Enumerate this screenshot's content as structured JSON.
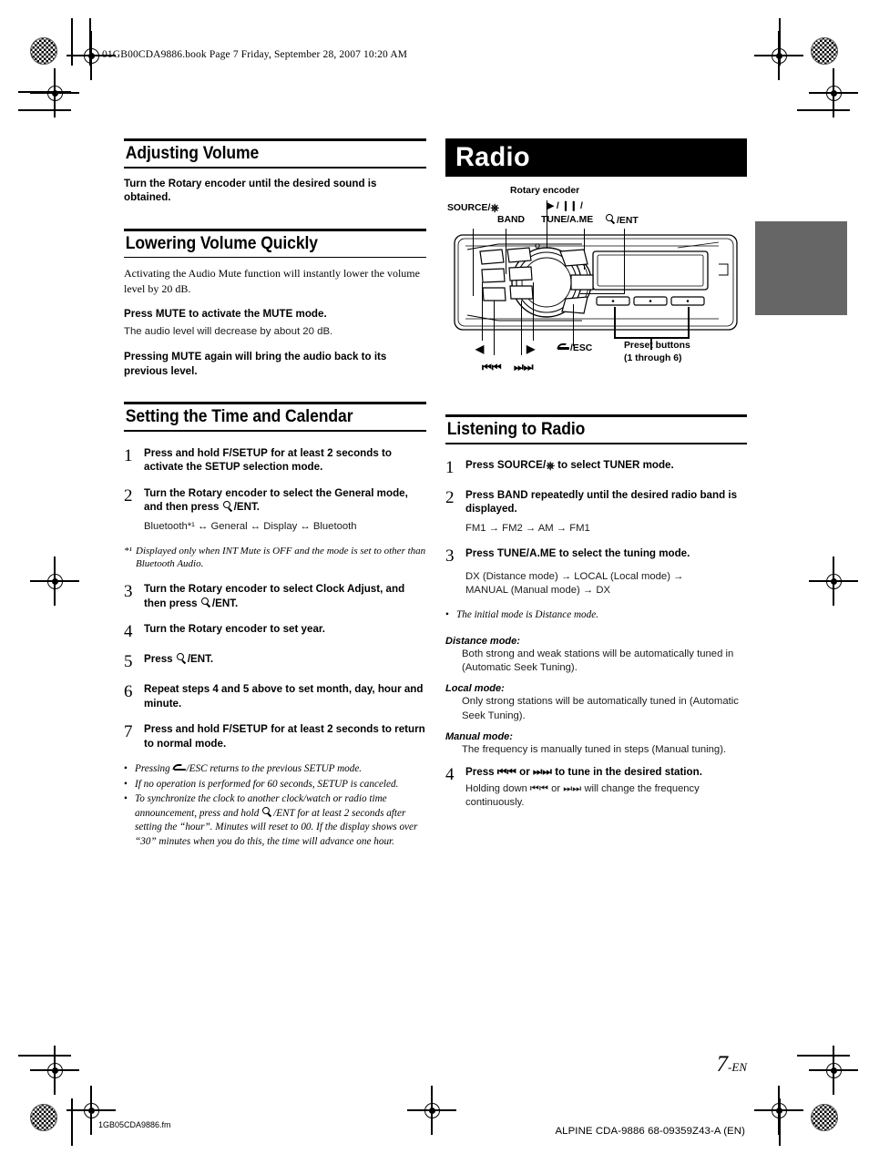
{
  "header": {
    "book_line": "01GB00CDA9886.book  Page 7  Friday, September 28, 2007  10:20 AM"
  },
  "left_column": {
    "section1": {
      "heading": "Adjusting Volume",
      "body_bold": "Turn the Rotary encoder until the desired sound is obtained.",
      "body_parts": {
        "pre": "Turn the ",
        "bold": "Rotary encoder",
        "post": " until the desired sound is obtained."
      }
    },
    "section2": {
      "heading": "Lowering Volume Quickly",
      "intro": "Activating the Audio Mute function will instantly lower the volume level by 20 dB.",
      "press_mute": {
        "pre": "Press ",
        "key": "MUTE",
        "post": " to activate the MUTE mode."
      },
      "press_mute_sub": "The audio level will decrease by about 20 dB.",
      "press_again": {
        "pre": "Pressing ",
        "key": "MUTE",
        "post": " again will bring the audio back to its previous level."
      }
    },
    "section3": {
      "heading": "Setting the Time and Calendar",
      "steps": [
        {
          "num": "1",
          "pre": "Press and hold ",
          "key": "F/SETUP",
          "post": " for at least 2 seconds to activate the SETUP selection mode."
        },
        {
          "num": "2",
          "pre": "Turn the ",
          "key": "Rotary encoder",
          "post": " to select the General mode, and then press ",
          "icon": "magnifier-icon",
          "tail": "/ENT."
        },
        {
          "num": "3",
          "pre": "Turn the ",
          "key": "Rotary encoder",
          "post": " to select Clock Adjust, and then press ",
          "icon": "magnifier-icon",
          "tail": "/ENT."
        },
        {
          "num": "4",
          "pre": "Turn the ",
          "key": "Rotary encoder",
          "post": " to set year."
        },
        {
          "num": "5",
          "pre": "Press ",
          "icon": "magnifier-icon",
          "tail": "/ENT."
        },
        {
          "num": "6",
          "pre": "Repeat steps 4 and 5 above to set month, day, hour and minute."
        },
        {
          "num": "7",
          "pre": "Press and hold ",
          "key": "F/SETUP",
          "post": " for at least 2 seconds to return to normal mode."
        }
      ],
      "mode_cycle": "Bluetooth*¹ ↔ General ↔ Display ↔ Bluetooth",
      "footnote": {
        "mark": "*¹",
        "text": "Displayed only when INT Mute is OFF and the mode is set to other than Bluetooth Audio."
      },
      "bullets": [
        {
          "pre": "Pressing ",
          "icon": "esc-return-icon",
          "post": "/ESC returns to the previous SETUP mode."
        },
        {
          "pre": "If no operation is performed for 60 seconds, SETUP is canceled."
        },
        {
          "pre": "To synchronize the clock to another clock/watch or radio time announcement, press and hold ",
          "icon": "magnifier-icon",
          "post": "/ENT for at least 2 seconds after setting the “hour”. Minutes will reset to 00. If the display shows over “30” minutes when you do this, the time will advance one hour."
        }
      ]
    }
  },
  "right_column": {
    "banner_title": "Radio",
    "diagram": {
      "labels": {
        "source": "SOURCE/",
        "source_icon": "power-icon",
        "band": "BAND",
        "rotary_encoder": "Rotary encoder",
        "play_pause": "▶ / ❙❙ /",
        "tune_ame": "TUNE/A.ME",
        "ent_icon": "magnifier-icon",
        "ent": "/ENT",
        "esc_icon": "esc-return-icon",
        "esc": "/ESC",
        "preset_line1": "Preset buttons",
        "preset_line2": "(1 through 6)",
        "left_arrow": "◀",
        "right_arrow": "▶",
        "prev_track": "⏮⏮",
        "next_track": "⏭⏭"
      }
    },
    "section": {
      "heading": "Listening to Radio",
      "steps": [
        {
          "num": "1",
          "pre": "Press ",
          "key": "SOURCE/",
          "key_icon": "power-icon",
          "post": " to select TUNER mode."
        },
        {
          "num": "2",
          "pre": "Press ",
          "key": "BAND",
          "post": " repeatedly until the desired radio band is displayed."
        },
        {
          "num": "3",
          "pre": "Press ",
          "key": "TUNE/A.ME",
          "post": " to select the tuning mode."
        },
        {
          "num": "4",
          "pre": "Press ",
          "key": "⏮⏮",
          "mid": " or ",
          "key2": "⏭⏭",
          "post": " to tune in the desired station.",
          "sub": "Holding down ⏮⏮ or ⏭⏭ will change the frequency continuously."
        }
      ],
      "band_cycle": "FM1 → FM2 → AM → FM1",
      "tune_cycle_line1": "DX (Distance mode) → LOCAL (Local mode) →",
      "tune_cycle_line2": "MANUAL (Manual mode) → DX",
      "initial_note": "The initial mode is Distance mode.",
      "modes": [
        {
          "title": "Distance mode:",
          "body": "Both strong and weak stations will be automatically tuned in (Automatic Seek Tuning)."
        },
        {
          "title": "Local mode:",
          "body": "Only strong stations will be automatically tuned in (Automatic Seek Tuning)."
        },
        {
          "title": "Manual mode:",
          "body": "The frequency is manually tuned in steps (Manual tuning)."
        }
      ]
    }
  },
  "footer": {
    "page_number": "7",
    "page_suffix": "-EN",
    "file_name": "1GB05CDA9886.fm",
    "imprint": "ALPINE CDA-9886 68-09359Z43-A (EN)"
  },
  "colors": {
    "banner_bg": "#000000",
    "thumb_tab": "#666666",
    "body_text": "#000000"
  }
}
